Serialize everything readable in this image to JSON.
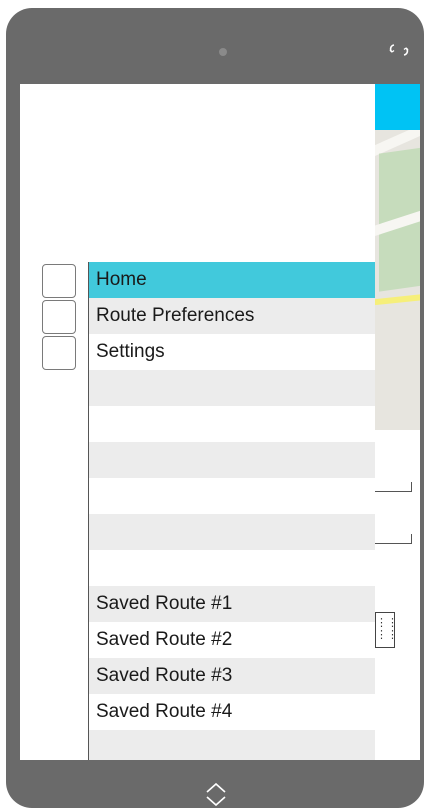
{
  "menu": {
    "items": [
      {
        "label": "Home"
      },
      {
        "label": "Route Preferences"
      },
      {
        "label": "Settings"
      },
      {
        "label": ""
      },
      {
        "label": ""
      },
      {
        "label": ""
      },
      {
        "label": ""
      },
      {
        "label": ""
      },
      {
        "label": ""
      },
      {
        "label": "Saved Route #1"
      },
      {
        "label": "Saved Route #2"
      },
      {
        "label": "Saved Route #3"
      },
      {
        "label": "Saved Route #4"
      },
      {
        "label": ""
      }
    ],
    "active_index": 0
  },
  "colors": {
    "active_row": "#41c9dc",
    "alt_row": "#ececec",
    "map_header": "#00c3f4",
    "device_frame": "#6a6a6a"
  },
  "icons": {
    "rotate": "rotate-icon",
    "camera": "camera-icon",
    "chevron": "chevron-up-down-icon",
    "grid": "grid-icon"
  }
}
